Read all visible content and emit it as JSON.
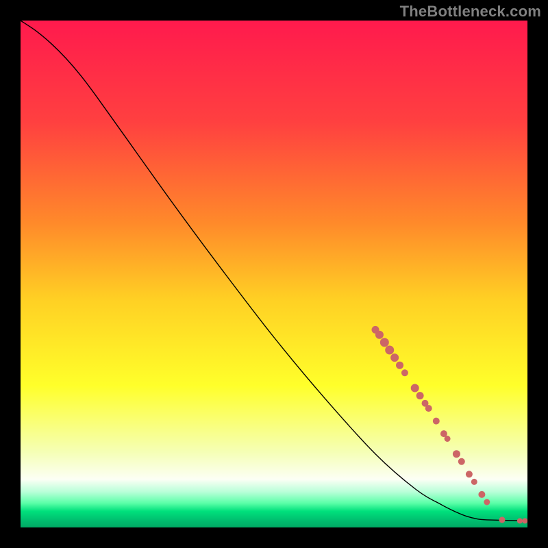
{
  "watermark": "TheBottleneck.com",
  "chart_data": {
    "type": "line",
    "title": "",
    "xlabel": "",
    "ylabel": "",
    "xlim": [
      0,
      100
    ],
    "ylim": [
      0,
      100
    ],
    "grid": false,
    "legend": false,
    "background_gradient_stops": [
      {
        "pos": 0.0,
        "color": "#ff1a4d"
      },
      {
        "pos": 0.2,
        "color": "#ff4040"
      },
      {
        "pos": 0.4,
        "color": "#ff8a2a"
      },
      {
        "pos": 0.55,
        "color": "#ffd024"
      },
      {
        "pos": 0.72,
        "color": "#ffff2a"
      },
      {
        "pos": 0.85,
        "color": "#f5ffb4"
      },
      {
        "pos": 0.905,
        "color": "#fcfff5"
      },
      {
        "pos": 0.93,
        "color": "#b8ffd8"
      },
      {
        "pos": 0.952,
        "color": "#5bffa8"
      },
      {
        "pos": 0.968,
        "color": "#00e07c"
      },
      {
        "pos": 0.985,
        "color": "#00c070"
      },
      {
        "pos": 1.0,
        "color": "#00a864"
      }
    ],
    "series": [
      {
        "name": "curve",
        "stroke": "#000000",
        "stroke_width": 1.4,
        "x": [
          0,
          3,
          6,
          9,
          12,
          15,
          20,
          30,
          40,
          50,
          60,
          70,
          78,
          83,
          86,
          88,
          90,
          92,
          100
        ],
        "y": [
          100,
          98,
          95.5,
          92.5,
          89,
          85,
          78,
          64,
          50.5,
          37.5,
          25.5,
          14.5,
          7.5,
          4.5,
          3.0,
          2.2,
          1.7,
          1.5,
          1.3
        ]
      }
    ],
    "markers": {
      "color": "#cc6666",
      "radius_range": [
        3.5,
        7.0
      ],
      "points": [
        {
          "x": 70.0,
          "y": 39.0,
          "r": 5.5
        },
        {
          "x": 70.8,
          "y": 38.0,
          "r": 6.0
        },
        {
          "x": 71.8,
          "y": 36.5,
          "r": 6.5
        },
        {
          "x": 72.8,
          "y": 35.0,
          "r": 6.5
        },
        {
          "x": 73.8,
          "y": 33.5,
          "r": 6.0
        },
        {
          "x": 74.8,
          "y": 32.0,
          "r": 5.5
        },
        {
          "x": 75.8,
          "y": 30.5,
          "r": 5.0
        },
        {
          "x": 77.8,
          "y": 27.5,
          "r": 6.0
        },
        {
          "x": 78.8,
          "y": 26.0,
          "r": 5.5
        },
        {
          "x": 79.8,
          "y": 24.5,
          "r": 5.0
        },
        {
          "x": 80.5,
          "y": 23.5,
          "r": 5.0
        },
        {
          "x": 82.0,
          "y": 21.0,
          "r": 5.0
        },
        {
          "x": 83.5,
          "y": 18.5,
          "r": 5.0
        },
        {
          "x": 84.2,
          "y": 17.5,
          "r": 4.5
        },
        {
          "x": 86.0,
          "y": 14.5,
          "r": 5.5
        },
        {
          "x": 87.0,
          "y": 13.0,
          "r": 5.0
        },
        {
          "x": 88.5,
          "y": 10.5,
          "r": 5.0
        },
        {
          "x": 89.5,
          "y": 9.0,
          "r": 4.5
        },
        {
          "x": 91.0,
          "y": 6.5,
          "r": 5.0
        },
        {
          "x": 92.0,
          "y": 5.0,
          "r": 4.5
        },
        {
          "x": 95.0,
          "y": 1.5,
          "r": 4.5
        },
        {
          "x": 98.5,
          "y": 1.3,
          "r": 4.0
        },
        {
          "x": 99.5,
          "y": 1.3,
          "r": 4.0
        }
      ]
    }
  }
}
